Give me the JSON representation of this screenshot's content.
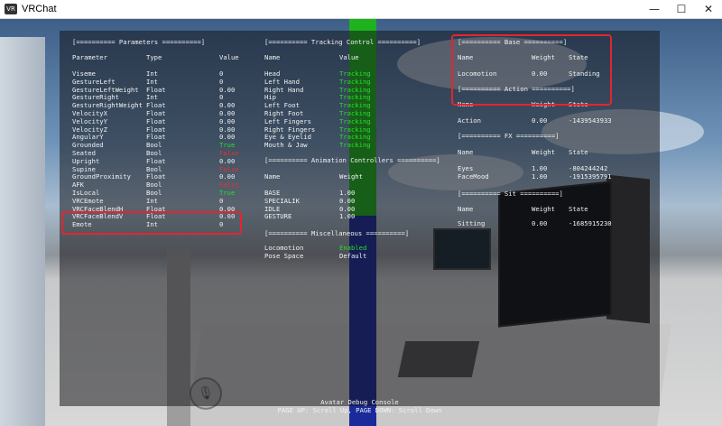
{
  "window": {
    "title": "VRChat",
    "icon_text": "VR",
    "minimize": "—",
    "maximize": "☐",
    "close": "✕"
  },
  "parameters": {
    "header": "[========== Parameters ==========]",
    "col_name": "Parameter",
    "col_type": "Type",
    "col_value": "Value",
    "rows": [
      {
        "name": "Viseme",
        "type": "Int",
        "value": "0"
      },
      {
        "name": "GestureLeft",
        "type": "Int",
        "value": "0"
      },
      {
        "name": "GestureLeftWeight",
        "type": "Float",
        "value": "0.00"
      },
      {
        "name": "GestureRight",
        "type": "Int",
        "value": "0"
      },
      {
        "name": "GestureRightWeight",
        "type": "Float",
        "value": "0.00"
      },
      {
        "name": "VelocityX",
        "type": "Float",
        "value": "0.00"
      },
      {
        "name": "VelocityY",
        "type": "Float",
        "value": "0.00"
      },
      {
        "name": "VelocityZ",
        "type": "Float",
        "value": "0.00"
      },
      {
        "name": "AngularY",
        "type": "Float",
        "value": "0.00"
      },
      {
        "name": "Grounded",
        "type": "Bool",
        "value": "True",
        "color": "green"
      },
      {
        "name": "Seated",
        "type": "Bool",
        "value": "False",
        "color": "red"
      },
      {
        "name": "Upright",
        "type": "Float",
        "value": "0.00"
      },
      {
        "name": "Supine",
        "type": "Bool",
        "value": "False",
        "color": "red"
      },
      {
        "name": "GroundProximity",
        "type": "Float",
        "value": "0.00"
      },
      {
        "name": "AFK",
        "type": "Bool",
        "value": "False",
        "color": "red"
      },
      {
        "name": "IsLocal",
        "type": "Bool",
        "value": "True",
        "color": "green"
      },
      {
        "name": "VRCEmote",
        "type": "Int",
        "value": "0"
      },
      {
        "name": "VRCFaceBlendH",
        "type": "Float",
        "value": "0.00"
      },
      {
        "name": "VRCFaceBlendV",
        "type": "Float",
        "value": "0.00"
      },
      {
        "name": "Emote",
        "type": "Int",
        "value": "0"
      }
    ]
  },
  "tracking": {
    "header": "[========== Tracking Control ==========]",
    "col_name": "Name",
    "col_value": "Value",
    "rows": [
      {
        "name": "Head",
        "value": "Tracking"
      },
      {
        "name": "Left Hand",
        "value": "Tracking"
      },
      {
        "name": "Right Hand",
        "value": "Tracking"
      },
      {
        "name": "Hip",
        "value": "Tracking"
      },
      {
        "name": "Left Foot",
        "value": "Tracking"
      },
      {
        "name": "Right Foot",
        "value": "Tracking"
      },
      {
        "name": "Left Fingers",
        "value": "Tracking"
      },
      {
        "name": "Right Fingers",
        "value": "Tracking"
      },
      {
        "name": "Eye & Eyelid",
        "value": "Tracking"
      },
      {
        "name": "Mouth & Jaw",
        "value": "Tracking"
      }
    ]
  },
  "animation": {
    "header": "[========== Animation Controllers ==========]",
    "col_name": "Name",
    "col_weight": "Weight",
    "rows": [
      {
        "name": "BASE",
        "weight": "1.00"
      },
      {
        "name": "SPECIALIK",
        "weight": "0.00"
      },
      {
        "name": "IDLE",
        "weight": "0.00"
      },
      {
        "name": "GESTURE",
        "weight": "1.00"
      }
    ]
  },
  "misc": {
    "header": "[========== Miscellaneous ==========]",
    "rows": [
      {
        "name": "Locomotion",
        "value": "Enabled",
        "color": "green"
      },
      {
        "name": "Pose Space",
        "value": "Default"
      }
    ]
  },
  "layers": {
    "col_name": "Name",
    "col_weight": "Weight",
    "col_state": "State",
    "base": {
      "header": "[========== Base ==========]",
      "rows": [
        {
          "name": "Locomotion",
          "weight": "0.00",
          "state": "Standing"
        }
      ]
    },
    "action": {
      "header": "[========== Action ==========]",
      "rows": [
        {
          "name": "Action",
          "weight": "0.00",
          "state": "-1439543933"
        }
      ]
    },
    "fx": {
      "header": "[========== FX ==========]",
      "rows": [
        {
          "name": "Eyes",
          "weight": "1.00",
          "state": "-804244242"
        },
        {
          "name": "FaceMood",
          "weight": "1.00",
          "state": "-1915395791"
        }
      ]
    },
    "sit": {
      "header": "[========== Sit ==========]",
      "rows": [
        {
          "name": "Sitting",
          "weight": "0.00",
          "state": "-1685915230"
        }
      ]
    }
  },
  "footer": {
    "title": "Avatar Debug Console",
    "hint": "PAGE UP: Scroll Up, PAGE DOWN: Scroll Down"
  },
  "colors": {
    "green": "#27e027",
    "red": "#e83030",
    "annotation": "#e3252f"
  }
}
